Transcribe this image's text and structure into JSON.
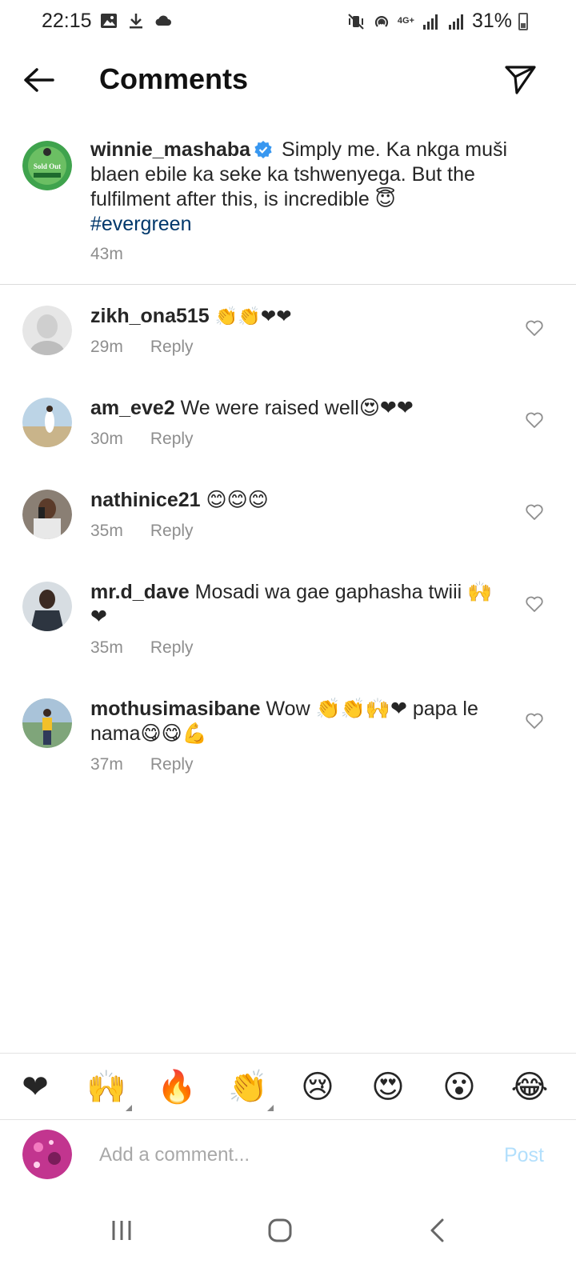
{
  "status_bar": {
    "time": "22:15",
    "battery": "31%",
    "network": "4G+",
    "left_icons": [
      "image-icon",
      "download-icon",
      "cloud-icon"
    ],
    "right_icons": [
      "mute-vibrate-icon",
      "hotspot-icon",
      "signal-icon",
      "signal-icon",
      "battery-icon"
    ]
  },
  "header": {
    "title": "Comments",
    "back_icon": "arrow-left-icon",
    "share_icon": "paper-plane-icon"
  },
  "caption": {
    "username": "winnie_mashaba",
    "verified": true,
    "text": "Simply me. Ka nkga muši blaen ebile ka seke ka tshwenyega. But the fulfilment after this, is incredible 😇",
    "hashtag": "#evergreen",
    "time": "43m",
    "avatar_text": "Sold Out"
  },
  "comments": [
    {
      "username": "zikh_ona515",
      "text": "👏👏❤❤",
      "time": "29m",
      "reply_label": "Reply"
    },
    {
      "username": "am_eve2",
      "text": "We were raised well😍❤❤",
      "time": "30m",
      "reply_label": "Reply"
    },
    {
      "username": "nathinice21",
      "text": "😊😊😊",
      "time": "35m",
      "reply_label": "Reply"
    },
    {
      "username": "mr.d_dave",
      "text": "Mosadi wa gae gaphasha twiii 🙌❤",
      "time": "35m",
      "reply_label": "Reply"
    },
    {
      "username": "mothusimasibane",
      "text": "Wow 👏👏🙌❤ papa le nama😋😋💪",
      "time": "37m",
      "reply_label": "Reply"
    }
  ],
  "emoji_bar": [
    "❤",
    "🙌",
    "🔥",
    "👏",
    "😢",
    "😍",
    "😮",
    "😂"
  ],
  "composer": {
    "placeholder": "Add a comment...",
    "post_label": "Post"
  },
  "colors": {
    "link": "#00376b",
    "secondary_text": "#8e8e8e",
    "post_disabled": "#b2dffc",
    "verified_blue": "#3897f0",
    "heart_red": "#e0245e"
  }
}
